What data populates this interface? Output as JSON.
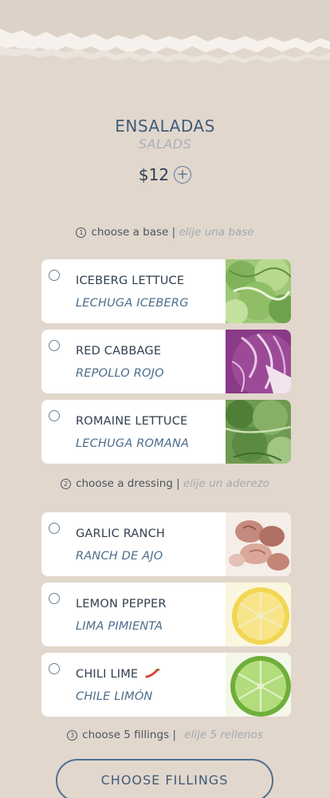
{
  "header": {
    "title_en": "ENSALADAS",
    "title_es": "SALADS",
    "price": "$12",
    "add_icon": "plus-circle-icon"
  },
  "steps": [
    {
      "number": "1",
      "label_en": "choose a base",
      "separator": "|",
      "label_es": "elije una base"
    },
    {
      "number": "2",
      "label_en": "choose a dressing",
      "separator": "|",
      "label_es": "elije un aderezo"
    },
    {
      "number": "3",
      "label_en": "choose 5 fillings",
      "separator": "|",
      "label_es": "elije 5 rellenos"
    }
  ],
  "bases": [
    {
      "name_en": "ICEBERG LETTUCE",
      "name_es": "LECHUGA ICEBERG",
      "image": "iceberg-lettuce-image"
    },
    {
      "name_en": "RED CABBAGE",
      "name_es": "REPOLLO ROJO",
      "image": "red-cabbage-image"
    },
    {
      "name_en": "ROMAINE LETTUCE",
      "name_es": "LECHUGA ROMANA",
      "image": "romaine-lettuce-image"
    }
  ],
  "dressings": [
    {
      "name_en": "GARLIC RANCH",
      "name_es": "RANCH DE AJO",
      "image": "garlic-image"
    },
    {
      "name_en": "LEMON PEPPER",
      "name_es": "LIMA PIMIENTA",
      "image": "lemon-image"
    },
    {
      "name_en": "CHILI LIME",
      "name_es": "CHILE LIMÓN",
      "image": "lime-image",
      "badge": "chili-pepper-icon"
    }
  ],
  "cta": {
    "label": "CHOOSE FILLINGS"
  },
  "colors": {
    "background": "#e2d7cd",
    "accent": "#3f5c79",
    "italic_text": "#4c6d8d",
    "card": "#ffffff"
  }
}
